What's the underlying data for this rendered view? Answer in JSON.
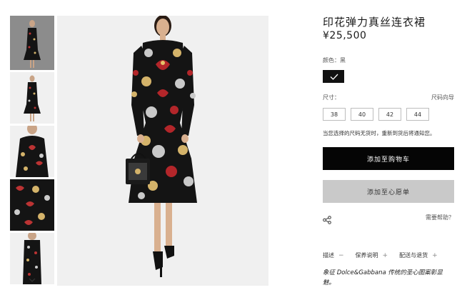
{
  "product": {
    "title": "印花弹力真丝连衣裙",
    "price": "¥25,500"
  },
  "color": {
    "label": "颜色：黑",
    "selected_value": "黑",
    "swatch_hex": "#111111"
  },
  "size": {
    "label": "尺寸：",
    "guide_label": "尺码向导",
    "options": [
      "38",
      "40",
      "42",
      "44"
    ]
  },
  "notice": "当您选择的尺码无货时，重新到货后将通知您。",
  "buttons": {
    "add_to_cart": "添加至购物车",
    "add_to_wishlist": "添加至心愿单"
  },
  "help_label": "需要帮助？",
  "tabs": [
    {
      "label": "描述",
      "symbol": "−"
    },
    {
      "label": "保养说明",
      "symbol": "+"
    },
    {
      "label": "配送与退货",
      "symbol": "+"
    }
  ],
  "description": "象征 Dolce&Gabbana 传统的圣心图案彰显魅。",
  "icons": {
    "thumb_prev": "chevron-up-icon",
    "thumb_next": "chevron-down-icon",
    "share": "share-icon",
    "swatch_selected": "check-icon"
  },
  "colors": {
    "cart_button_bg": "#050505",
    "wish_button_bg": "#c9c9c9",
    "image_bg": "#f0f0f0",
    "active_thumb_bg": "#8c8c8c"
  }
}
